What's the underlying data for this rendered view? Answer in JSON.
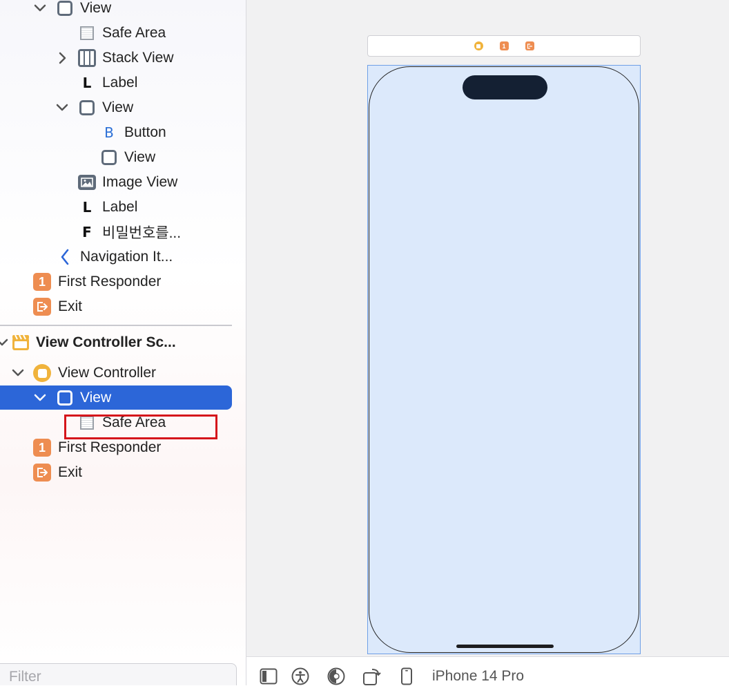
{
  "outline": {
    "top_items": [
      {
        "label": "View",
        "icon": "view-icon"
      },
      {
        "label": "Safe Area",
        "icon": "safe-area-icon"
      },
      {
        "label": "Stack View",
        "icon": "stack-view-icon"
      },
      {
        "label": "Label",
        "icon_text": "L"
      },
      {
        "label": "View",
        "icon": "view-icon"
      },
      {
        "label": "Button",
        "icon_text": "B"
      },
      {
        "label": "View",
        "icon": "view-icon"
      },
      {
        "label": "Image View",
        "icon": "image-view-icon"
      },
      {
        "label": "Label",
        "icon_text": "L"
      },
      {
        "label": "비밀번호를...",
        "icon_text": "F"
      },
      {
        "label": "Navigation It...",
        "icon": "back-chevron-icon"
      },
      {
        "label": "First Responder",
        "icon_text": "1"
      },
      {
        "label": "Exit",
        "icon": "exit-icon"
      }
    ],
    "scene": {
      "label": "View Controller Sc...",
      "items": [
        {
          "label": "View Controller",
          "icon": "view-controller-icon"
        },
        {
          "label": "View",
          "icon": "view-icon",
          "selected": true
        },
        {
          "label": "Safe Area",
          "icon": "safe-area-icon",
          "highlighted": true
        },
        {
          "label": "First Responder",
          "icon_text": "1"
        },
        {
          "label": "Exit",
          "icon": "exit-icon"
        }
      ]
    },
    "filter_placeholder": "Filter"
  },
  "canvas": {
    "scene_bar_icons": [
      "view-controller-icon",
      "first-responder-icon",
      "exit-icon"
    ],
    "first_responder_text": "1"
  },
  "toolbar": {
    "device_name": "iPhone 14 Pro",
    "icons": [
      "sidebar-icon",
      "accessibility-icon",
      "appearance-icon",
      "rotate-icon",
      "device-icon"
    ]
  },
  "colors": {
    "selection": "#2c66d8",
    "highlight_box": "#d5151b",
    "badge_orange": "#ee8d51",
    "vc_yellow": "#f0b33c",
    "device_fill": "#dce9fb"
  }
}
